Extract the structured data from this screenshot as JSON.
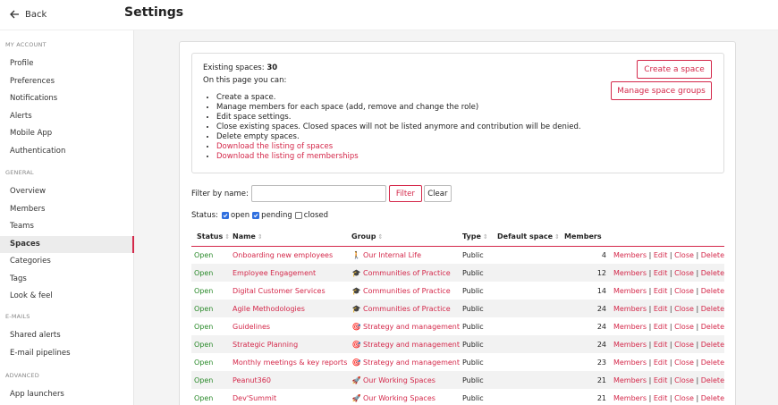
{
  "header": {
    "back_label": "Back",
    "title": "Settings"
  },
  "sidebar": {
    "sections": [
      {
        "title": "MY ACCOUNT",
        "items": [
          "Profile",
          "Preferences",
          "Notifications",
          "Alerts",
          "Mobile App",
          "Authentication"
        ]
      },
      {
        "title": "GENERAL",
        "items": [
          "Overview",
          "Members",
          "Teams",
          "Spaces",
          "Categories",
          "Tags",
          "Look & feel"
        ]
      },
      {
        "title": "E-MAILS",
        "items": [
          "Shared alerts",
          "E-mail pipelines"
        ]
      },
      {
        "title": "ADVANCED",
        "items": [
          "App launchers"
        ]
      }
    ],
    "active": "Spaces"
  },
  "info": {
    "existing_label": "Existing spaces:",
    "existing_count": "30",
    "intro": "On this page you can:",
    "bullets": [
      "Create a space.",
      "Manage members for each space (add, remove and change the role)",
      "Edit space settings.",
      "Close existing spaces. Closed spaces will not be listed anymore and contribution will be denied.",
      "Delete empty spaces."
    ],
    "links": [
      "Download the listing of spaces",
      "Download the listing of memberships"
    ],
    "create_button": "Create a space",
    "manage_button": "Manage space groups"
  },
  "filter": {
    "label": "Filter by name:",
    "value": "",
    "filter_button": "Filter",
    "clear_button": "Clear"
  },
  "status_filter": {
    "label": "Status:",
    "options": [
      {
        "label": "open",
        "checked": true
      },
      {
        "label": "pending",
        "checked": true
      },
      {
        "label": "closed",
        "checked": false
      }
    ]
  },
  "table": {
    "columns": [
      "Status",
      "Name",
      "Group",
      "Type",
      "Default space",
      "Members"
    ],
    "actions": [
      "Members",
      "Edit",
      "Close",
      "Delete"
    ],
    "rows": [
      {
        "status": "Open",
        "name": "Onboarding new employees",
        "group_icon": "person-icon",
        "group": "Our Internal Life",
        "type": "Public",
        "default": "",
        "members": "4"
      },
      {
        "status": "Open",
        "name": "Employee Engagement",
        "group_icon": "graduation-cap-icon",
        "group": "Communities of Practice",
        "type": "Public",
        "default": "",
        "members": "12"
      },
      {
        "status": "Open",
        "name": "Digital Customer Services",
        "group_icon": "graduation-cap-icon",
        "group": "Communities of Practice",
        "type": "Public",
        "default": "",
        "members": "14"
      },
      {
        "status": "Open",
        "name": "Agile Methodologies",
        "group_icon": "graduation-cap-icon",
        "group": "Communities of Practice",
        "type": "Public",
        "default": "",
        "members": "24"
      },
      {
        "status": "Open",
        "name": "Guidelines",
        "group_icon": "target-icon",
        "group": "Strategy and management",
        "type": "Public",
        "default": "",
        "members": "24"
      },
      {
        "status": "Open",
        "name": "Strategic Planning",
        "group_icon": "target-icon",
        "group": "Strategy and management",
        "type": "Public",
        "default": "",
        "members": "24"
      },
      {
        "status": "Open",
        "name": "Monthly meetings & key reports",
        "group_icon": "target-icon",
        "group": "Strategy and management",
        "type": "Public",
        "default": "",
        "members": "23"
      },
      {
        "status": "Open",
        "name": "Peanut360",
        "group_icon": "rocket-icon",
        "group": "Our Working Spaces",
        "type": "Public",
        "default": "",
        "members": "21"
      },
      {
        "status": "Open",
        "name": "Dev'Summit",
        "group_icon": "rocket-icon",
        "group": "Our Working Spaces",
        "type": "Public",
        "default": "",
        "members": "21"
      }
    ]
  },
  "colors": {
    "accent": "#d4284a",
    "status_open": "#2a8a2a",
    "checkbox": "#2f6fdf"
  }
}
